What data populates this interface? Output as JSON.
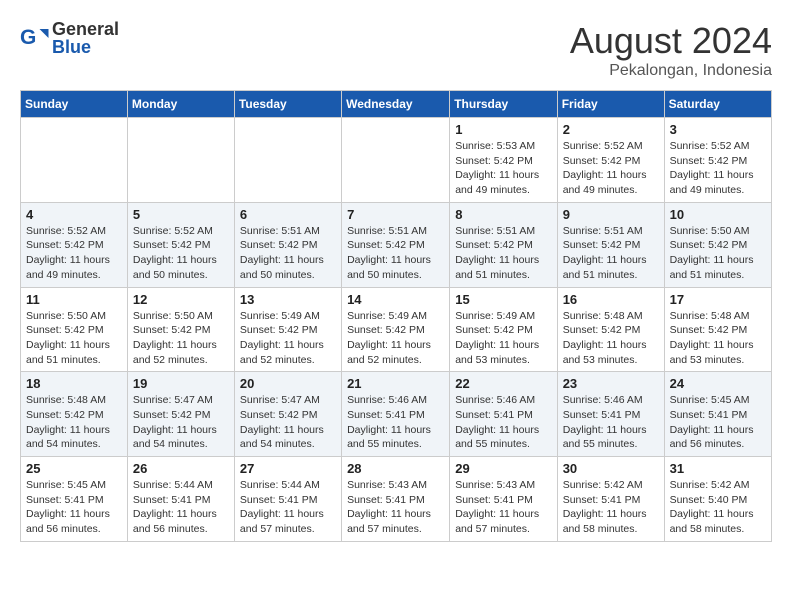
{
  "header": {
    "logo_general": "General",
    "logo_blue": "Blue",
    "month_year": "August 2024",
    "location": "Pekalongan, Indonesia"
  },
  "days_of_week": [
    "Sunday",
    "Monday",
    "Tuesday",
    "Wednesday",
    "Thursday",
    "Friday",
    "Saturday"
  ],
  "weeks": [
    [
      {
        "day": "",
        "info": ""
      },
      {
        "day": "",
        "info": ""
      },
      {
        "day": "",
        "info": ""
      },
      {
        "day": "",
        "info": ""
      },
      {
        "day": "1",
        "info": "Sunrise: 5:53 AM\nSunset: 5:42 PM\nDaylight: 11 hours\nand 49 minutes."
      },
      {
        "day": "2",
        "info": "Sunrise: 5:52 AM\nSunset: 5:42 PM\nDaylight: 11 hours\nand 49 minutes."
      },
      {
        "day": "3",
        "info": "Sunrise: 5:52 AM\nSunset: 5:42 PM\nDaylight: 11 hours\nand 49 minutes."
      }
    ],
    [
      {
        "day": "4",
        "info": "Sunrise: 5:52 AM\nSunset: 5:42 PM\nDaylight: 11 hours\nand 49 minutes."
      },
      {
        "day": "5",
        "info": "Sunrise: 5:52 AM\nSunset: 5:42 PM\nDaylight: 11 hours\nand 50 minutes."
      },
      {
        "day": "6",
        "info": "Sunrise: 5:51 AM\nSunset: 5:42 PM\nDaylight: 11 hours\nand 50 minutes."
      },
      {
        "day": "7",
        "info": "Sunrise: 5:51 AM\nSunset: 5:42 PM\nDaylight: 11 hours\nand 50 minutes."
      },
      {
        "day": "8",
        "info": "Sunrise: 5:51 AM\nSunset: 5:42 PM\nDaylight: 11 hours\nand 51 minutes."
      },
      {
        "day": "9",
        "info": "Sunrise: 5:51 AM\nSunset: 5:42 PM\nDaylight: 11 hours\nand 51 minutes."
      },
      {
        "day": "10",
        "info": "Sunrise: 5:50 AM\nSunset: 5:42 PM\nDaylight: 11 hours\nand 51 minutes."
      }
    ],
    [
      {
        "day": "11",
        "info": "Sunrise: 5:50 AM\nSunset: 5:42 PM\nDaylight: 11 hours\nand 51 minutes."
      },
      {
        "day": "12",
        "info": "Sunrise: 5:50 AM\nSunset: 5:42 PM\nDaylight: 11 hours\nand 52 minutes."
      },
      {
        "day": "13",
        "info": "Sunrise: 5:49 AM\nSunset: 5:42 PM\nDaylight: 11 hours\nand 52 minutes."
      },
      {
        "day": "14",
        "info": "Sunrise: 5:49 AM\nSunset: 5:42 PM\nDaylight: 11 hours\nand 52 minutes."
      },
      {
        "day": "15",
        "info": "Sunrise: 5:49 AM\nSunset: 5:42 PM\nDaylight: 11 hours\nand 53 minutes."
      },
      {
        "day": "16",
        "info": "Sunrise: 5:48 AM\nSunset: 5:42 PM\nDaylight: 11 hours\nand 53 minutes."
      },
      {
        "day": "17",
        "info": "Sunrise: 5:48 AM\nSunset: 5:42 PM\nDaylight: 11 hours\nand 53 minutes."
      }
    ],
    [
      {
        "day": "18",
        "info": "Sunrise: 5:48 AM\nSunset: 5:42 PM\nDaylight: 11 hours\nand 54 minutes."
      },
      {
        "day": "19",
        "info": "Sunrise: 5:47 AM\nSunset: 5:42 PM\nDaylight: 11 hours\nand 54 minutes."
      },
      {
        "day": "20",
        "info": "Sunrise: 5:47 AM\nSunset: 5:42 PM\nDaylight: 11 hours\nand 54 minutes."
      },
      {
        "day": "21",
        "info": "Sunrise: 5:46 AM\nSunset: 5:41 PM\nDaylight: 11 hours\nand 55 minutes."
      },
      {
        "day": "22",
        "info": "Sunrise: 5:46 AM\nSunset: 5:41 PM\nDaylight: 11 hours\nand 55 minutes."
      },
      {
        "day": "23",
        "info": "Sunrise: 5:46 AM\nSunset: 5:41 PM\nDaylight: 11 hours\nand 55 minutes."
      },
      {
        "day": "24",
        "info": "Sunrise: 5:45 AM\nSunset: 5:41 PM\nDaylight: 11 hours\nand 56 minutes."
      }
    ],
    [
      {
        "day": "25",
        "info": "Sunrise: 5:45 AM\nSunset: 5:41 PM\nDaylight: 11 hours\nand 56 minutes."
      },
      {
        "day": "26",
        "info": "Sunrise: 5:44 AM\nSunset: 5:41 PM\nDaylight: 11 hours\nand 56 minutes."
      },
      {
        "day": "27",
        "info": "Sunrise: 5:44 AM\nSunset: 5:41 PM\nDaylight: 11 hours\nand 57 minutes."
      },
      {
        "day": "28",
        "info": "Sunrise: 5:43 AM\nSunset: 5:41 PM\nDaylight: 11 hours\nand 57 minutes."
      },
      {
        "day": "29",
        "info": "Sunrise: 5:43 AM\nSunset: 5:41 PM\nDaylight: 11 hours\nand 57 minutes."
      },
      {
        "day": "30",
        "info": "Sunrise: 5:42 AM\nSunset: 5:41 PM\nDaylight: 11 hours\nand 58 minutes."
      },
      {
        "day": "31",
        "info": "Sunrise: 5:42 AM\nSunset: 5:40 PM\nDaylight: 11 hours\nand 58 minutes."
      }
    ]
  ]
}
